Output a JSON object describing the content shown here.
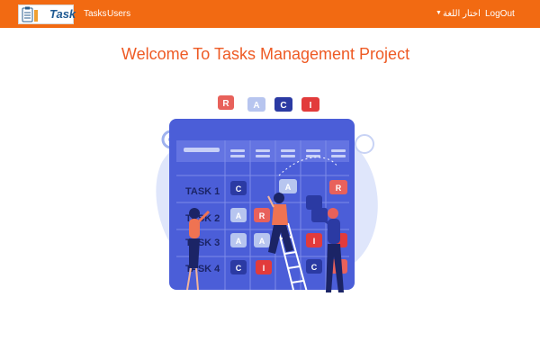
{
  "navbar": {
    "brand_text": "Task",
    "links": {
      "tasks": "Tasks",
      "users": "Users",
      "language": "اختار اللغة",
      "logout": "LogOut"
    },
    "caret_icon": "caret-down-icon",
    "background_color": "#f26a12"
  },
  "main": {
    "title": "Welcome To Tasks Management Project"
  },
  "illustration": {
    "raci_header": [
      "R",
      "A",
      "C",
      "I"
    ],
    "rows": [
      {
        "label": "TASK 1",
        "cells": [
          "C",
          "",
          "",
          "A",
          "R"
        ]
      },
      {
        "label": "TASK 2",
        "cells": [
          "A",
          "R",
          "",
          "",
          ""
        ]
      },
      {
        "label": "TASK 3",
        "cells": [
          "A",
          "A",
          "",
          "I",
          ""
        ]
      },
      {
        "label": "TASK 4",
        "cells": [
          "C",
          "I",
          "",
          "C",
          "R"
        ]
      }
    ]
  }
}
